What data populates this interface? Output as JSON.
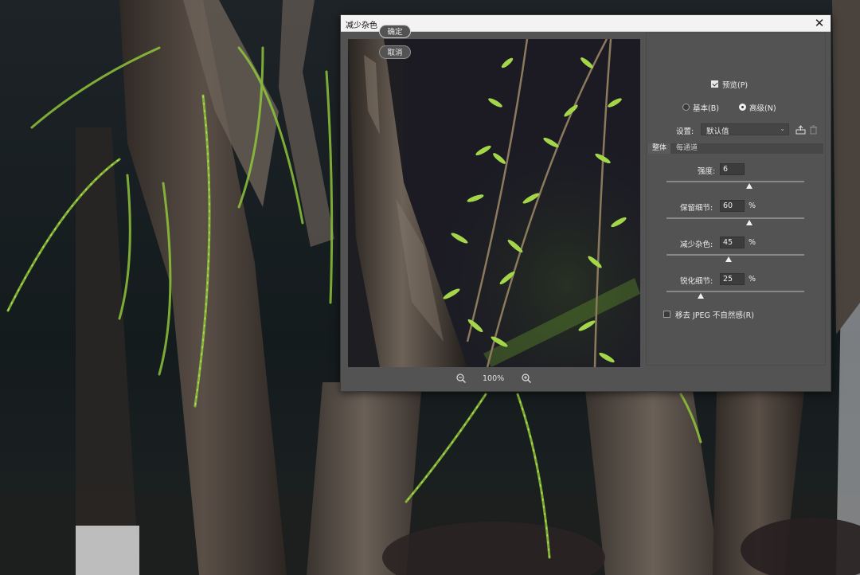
{
  "dialog": {
    "title": "减少杂色",
    "close_glyph": "✕",
    "ok_label": "确定",
    "cancel_label": "取消",
    "preview_label": "预览(P)",
    "preview_checked": true,
    "mode_basic": "基本(B)",
    "mode_advanced": "高级(N)",
    "mode_selected": "advanced",
    "settings_label": "设置:",
    "settings_value": "默认值",
    "save_icon": "save-preset-icon",
    "delete_icon": "trash-icon",
    "tabs": [
      "整体",
      "每通道"
    ],
    "active_tab": 0,
    "sliders": [
      {
        "label": "强度:",
        "value": "6",
        "unit": "",
        "fraction": 0.6
      },
      {
        "label": "保留细节:",
        "value": "60",
        "unit": "%",
        "fraction": 0.6
      },
      {
        "label": "减少杂色:",
        "value": "45",
        "unit": "%",
        "fraction": 0.45
      },
      {
        "label": "锐化细节:",
        "value": "25",
        "unit": "%",
        "fraction": 0.25
      }
    ],
    "jpeg_label": "移去 JPEG 不自然感(R)",
    "jpeg_checked": false,
    "zoom_value": "100%",
    "zoom_out_icon": "zoom-out-icon",
    "zoom_in_icon": "zoom-in-icon"
  },
  "colors": {
    "dialog_bg": "#535353",
    "leaf_green": "#9fd23c"
  }
}
